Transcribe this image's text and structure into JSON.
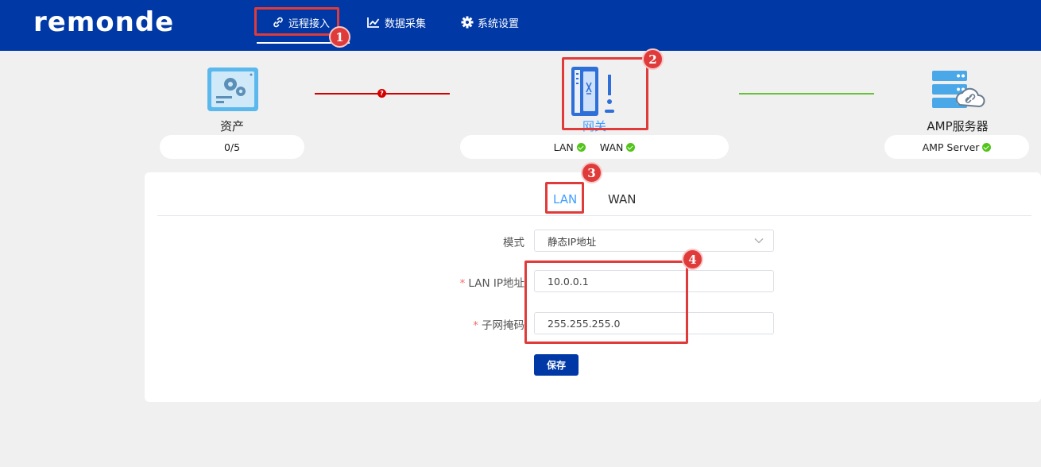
{
  "header": {
    "logo": "remonde",
    "nav": [
      {
        "label": "远程接入",
        "icon": "link-icon"
      },
      {
        "label": "数据采集",
        "icon": "chart-line-icon"
      },
      {
        "label": "系统设置",
        "icon": "gear-icon"
      }
    ]
  },
  "topology": {
    "assets": {
      "label": "资产",
      "value": "0/5"
    },
    "gateway": {
      "label": "网关",
      "lan": "LAN",
      "wan": "WAN"
    },
    "server": {
      "label": "AMP服务器",
      "status": "AMP Server"
    },
    "link_error_symbol": "?"
  },
  "tabs": [
    "LAN",
    "WAN"
  ],
  "form": {
    "mode_label": "模式",
    "mode_value": "静态IP地址",
    "required_mark": "*",
    "lan_ip_label": "LAN IP地址",
    "lan_ip_value": "10.0.0.1",
    "subnet_label": "子网掩码",
    "subnet_value": "255.255.255.0",
    "save_label": "保存"
  },
  "annotations": [
    "1",
    "2",
    "3",
    "4"
  ],
  "colors": {
    "brand": "#0039a6",
    "annotation": "#e03b3b",
    "ok": "#52c41a",
    "error": "#d40000",
    "active_tab": "#409eff"
  }
}
